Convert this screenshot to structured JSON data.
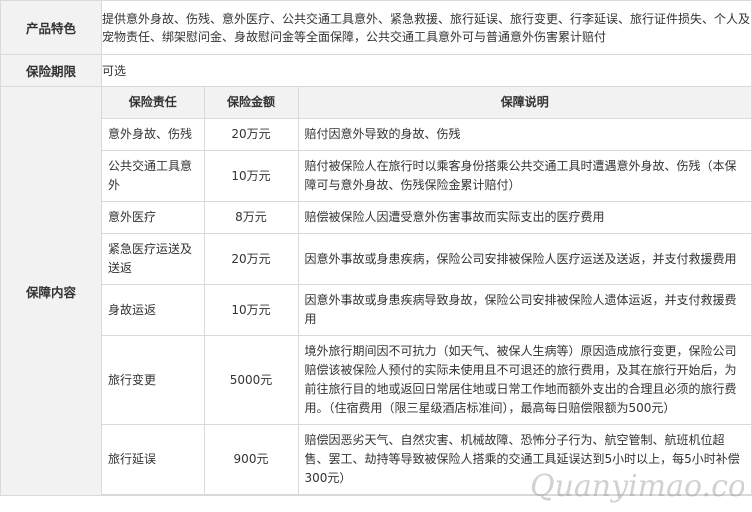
{
  "features": {
    "label": "产品特色",
    "text": "提供意外身故、伤残、意外医疗、公共交通工具意外、紧急救援、旅行延误、旅行变更、行李延误、旅行证件损失、个人及宠物责任、绑架慰问金、身故慰问金等全面保障，公共交通工具意外可与普通意外伤害累计赔付"
  },
  "period": {
    "label": "保险期限",
    "value": "可选"
  },
  "coverage": {
    "label": "保障内容",
    "headers": [
      "保险责任",
      "保险金额",
      "保障说明"
    ],
    "rows": [
      {
        "item": "意外身故、伤残",
        "amount": "20万元",
        "desc": "赔付因意外导致的身故、伤残"
      },
      {
        "item": "公共交通工具意外",
        "amount": "10万元",
        "desc": "赔付被保险人在旅行时以乘客身份搭乘公共交通工具时遭遇意外身故、伤残（本保障可与意外身故、伤残保险金累计赔付）"
      },
      {
        "item": "意外医疗",
        "amount": "8万元",
        "desc": "赔偿被保险人因遭受意外伤害事故而实际支出的医疗费用"
      },
      {
        "item": "紧急医疗运送及送返",
        "amount": "20万元",
        "desc": "因意外事故或身患疾病，保险公司安排被保险人医疗运送及送返，并支付救援费用"
      },
      {
        "item": "身故运返",
        "amount": "10万元",
        "desc": "因意外事故或身患疾病导致身故，保险公司安排被保险人遗体运返，并支付救援费用"
      },
      {
        "item": "旅行变更",
        "amount": "5000元",
        "desc": "境外旅行期间因不可抗力（如天气、被保人生病等）原因造成旅行变更，保险公司赔偿该被保险人预付的实际未使用且不可退还的旅行费用，及其在旅行开始后，为前往旅行目的地或返回日常居住地或日常工作地而额外支出的合理且必须的旅行费用。（住宿费用（限三星级酒店标准间），最高每日赔偿限额为500元）"
      },
      {
        "item": "旅行延误",
        "amount": "900元",
        "desc": "赔偿因恶劣天气、自然灾害、机械故障、恐怖分子行为、航空管制、航班机位超售、罢工、劫持等导致被保险人搭乘的交通工具延误达到5小时以上，每5小时补偿300元）"
      }
    ]
  },
  "watermark": {
    "text": "Quanyimao.com"
  }
}
